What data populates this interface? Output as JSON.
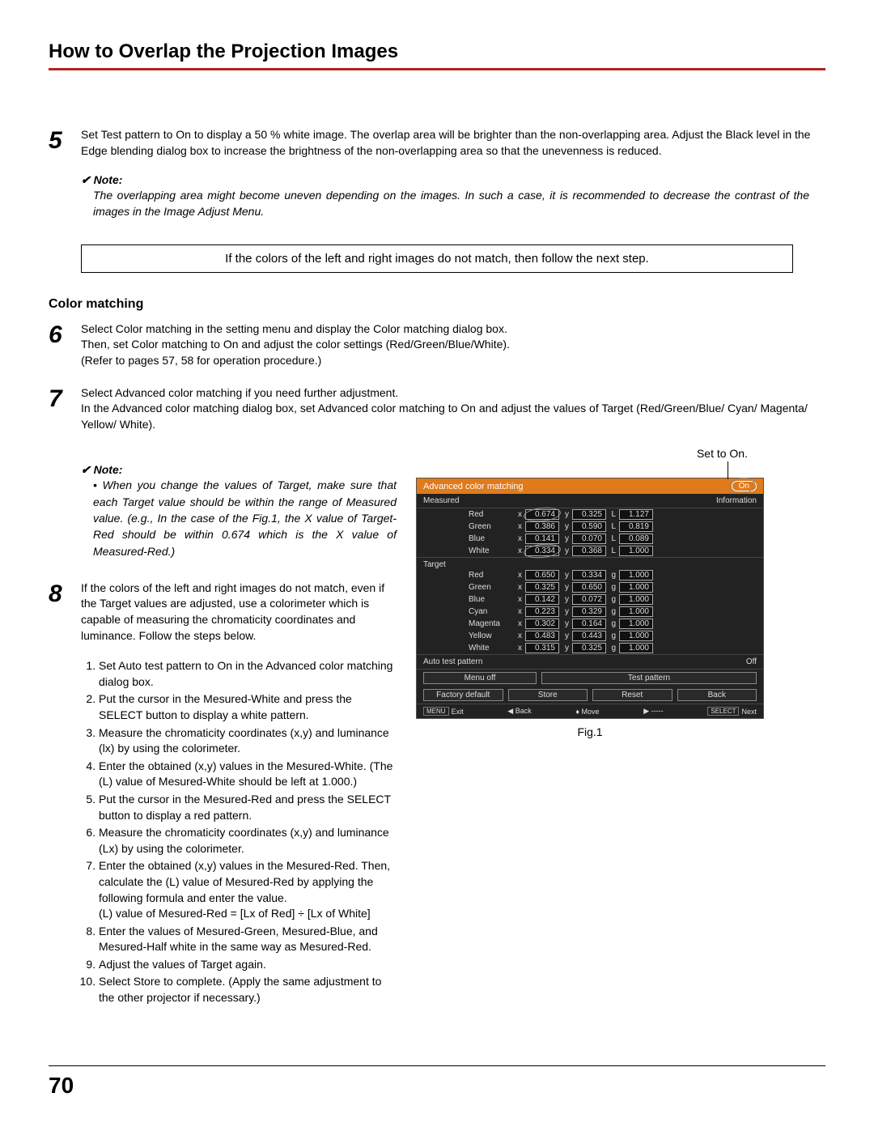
{
  "header": {
    "title": "How to Overlap the Projection Images"
  },
  "steps": {
    "s5": {
      "num": "5",
      "body": "Set Test pattern to On to display a 50 % white image. The overlap area will be brighter than the non-overlapping area. Adjust the Black level in the Edge blending dialog box to increase the brightness of the non-overlapping area so that the unevenness is reduced."
    },
    "note5": {
      "label": "Note:",
      "body": "The overlapping area might become uneven depending on the images. In such a case, it is recommended to decrease the contrast of the images in the Image Adjust Menu."
    },
    "boxed": "If the colors of the left and right images do not match, then follow the next step.",
    "subhead": "Color matching",
    "s6": {
      "num": "6",
      "body": "Select Color matching in the setting menu and display the Color matching dialog box.\nThen, set Color matching to On and adjust the color settings (Red/Green/Blue/White).\n(Refer to pages 57, 58 for operation procedure.)"
    },
    "s7": {
      "num": "7",
      "body": "Select Advanced color matching if you need further adjustment.\nIn the Advanced color matching dialog box, set Advanced color matching to On and adjust the values of Target (Red/Green/Blue/ Cyan/ Magenta/ Yellow/ White)."
    },
    "note7": {
      "label": "Note:",
      "body": "• When you change the values of Target, make sure that each Target value should be within the range of Measured value. (e.g., In the case of the Fig.1, the X value of Target-Red should be within 0.674 which is the X value of Measured-Red.)"
    },
    "s8": {
      "num": "8",
      "body": "If the colors of the left and right images do not match, even if the Target values are adjusted, use a colorimeter which is capable of measuring the chromaticity coordinates and luminance. Follow the steps below.",
      "ol": [
        "Set Auto test pattern to On in the Advanced color matching dialog box.",
        "Put the cursor in the Mesured-White and press the SELECT button to display a white pattern.",
        "Measure the chromaticity coordinates (x,y) and luminance (lx) by using the colorimeter.",
        "Enter the obtained (x,y) values in the Mesured-White. (The (L) value of Mesured-White should be left at 1.000.)",
        "Put the cursor in the Mesured-Red and press the SELECT button to display a red pattern.",
        "Measure the chromaticity coordinates (x,y) and luminance (Lx) by using the colorimeter.",
        "Enter the obtained (x,y) values in the Mesured-Red. Then, calculate the (L) value of Mesured-Red by applying the following formula and enter the value.\n(L) value of Mesured-Red = [Lx of Red] ÷ [Lx of White]",
        "Enter the values of Mesured-Green, Mesured-Blue, and Mesured-Half white in the same way as Mesured-Red.",
        "Adjust the values of Target again.",
        "Select Store to complete. (Apply the same adjustment to the other projector if necessary.)"
      ]
    }
  },
  "figure": {
    "set_to_on": "Set to On.",
    "caption": "Fig.1",
    "osd": {
      "title": "Advanced color matching",
      "on": "On",
      "measured_label": "Measured",
      "info_label": "Information",
      "target_label": "Target",
      "measured": [
        {
          "name": "Red",
          "x": "0.674",
          "y": "0.325",
          "k3": "L",
          "v3": "1.127"
        },
        {
          "name": "Green",
          "x": "0.386",
          "y": "0.590",
          "k3": "L",
          "v3": "0.819"
        },
        {
          "name": "Blue",
          "x": "0.141",
          "y": "0.070",
          "k3": "L",
          "v3": "0.089"
        },
        {
          "name": "White",
          "x": "0.334",
          "y": "0.368",
          "k3": "L",
          "v3": "1.000"
        }
      ],
      "target": [
        {
          "name": "Red",
          "x": "0.650",
          "y": "0.334",
          "k3": "g",
          "v3": "1.000"
        },
        {
          "name": "Green",
          "x": "0.325",
          "y": "0.650",
          "k3": "g",
          "v3": "1.000"
        },
        {
          "name": "Blue",
          "x": "0.142",
          "y": "0.072",
          "k3": "g",
          "v3": "1.000"
        },
        {
          "name": "Cyan",
          "x": "0.223",
          "y": "0.329",
          "k3": "g",
          "v3": "1.000"
        },
        {
          "name": "Magenta",
          "x": "0.302",
          "y": "0.164",
          "k3": "g",
          "v3": "1.000"
        },
        {
          "name": "Yellow",
          "x": "0.483",
          "y": "0.443",
          "k3": "g",
          "v3": "1.000"
        },
        {
          "name": "White",
          "x": "0.315",
          "y": "0.325",
          "k3": "g",
          "v3": "1.000"
        }
      ],
      "auto_test": "Auto test pattern",
      "auto_val": "Off",
      "buttons_row1": [
        "Menu off",
        "Test pattern"
      ],
      "buttons_row2": [
        "Factory default",
        "Store",
        "Reset",
        "Back"
      ],
      "footer": {
        "exit_k": "MENU",
        "exit": "Exit",
        "back": "◀ Back",
        "move": "♦ Move",
        "nextb": "▶ -----",
        "next_k": "SELECT",
        "next": "Next"
      }
    }
  },
  "page_number": "70"
}
